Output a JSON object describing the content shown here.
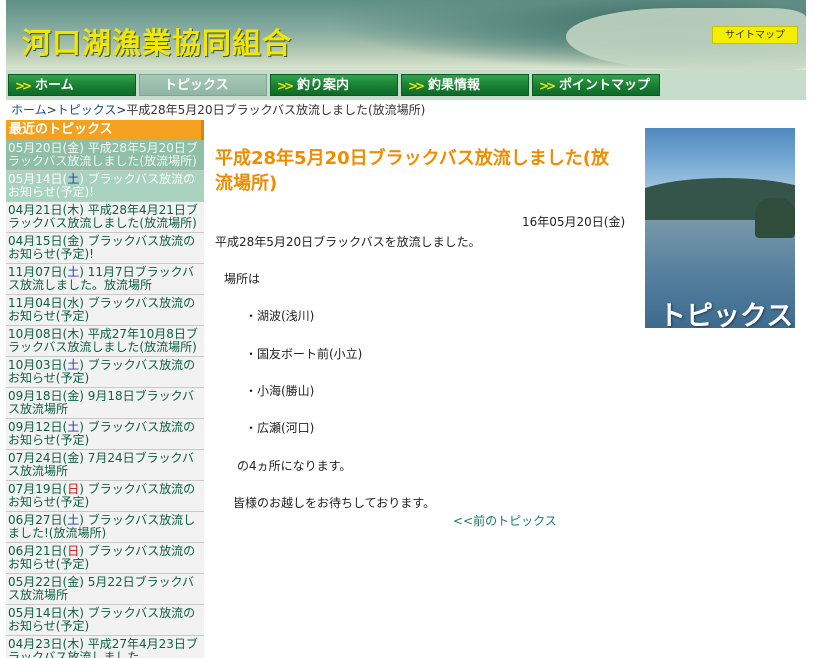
{
  "header": {
    "site_title": "河口湖漁業協同組合",
    "sitemap_label": "サイトマップ"
  },
  "nav": [
    {
      "label": "ホーム",
      "active": false
    },
    {
      "label": "トピックス",
      "active": true
    },
    {
      "label": "釣り案内",
      "active": false
    },
    {
      "label": "釣果情報",
      "active": false
    },
    {
      "label": "ポイントマップ",
      "active": false
    }
  ],
  "breadcrumb": {
    "home": "ホーム",
    "topics": "トピックス",
    "current": "平成28年5月20日ブラックバス放流しました(放流場所)",
    "sep": ">"
  },
  "sidebar": {
    "heading": "最近のトピックス",
    "items": [
      {
        "date": "05月20日(",
        "dow": "金",
        "dowtype": "",
        "rest": ") 平成28年5月20日ブラックバス放流しました(放流場所)"
      },
      {
        "date": "05月14日(",
        "dow": "土",
        "dowtype": "sat",
        "rest": ") ブラックバス放流のお知らせ(予定)!"
      },
      {
        "date": "04月21日(",
        "dow": "木",
        "dowtype": "",
        "rest": ") 平成28年4月21日ブラックバス放流しました(放流場所)"
      },
      {
        "date": "04月15日(",
        "dow": "金",
        "dowtype": "",
        "rest": ") ブラックバス放流のお知らせ(予定)!"
      },
      {
        "date": "11月07日(",
        "dow": "土",
        "dowtype": "sat",
        "rest": ") 11月7日ブラックバス放流しました。放流場所"
      },
      {
        "date": "11月04日(",
        "dow": "水",
        "dowtype": "",
        "rest": ") ブラックバス放流のお知らせ(予定)"
      },
      {
        "date": "10月08日(",
        "dow": "木",
        "dowtype": "",
        "rest": ") 平成27年10月8日ブラックバス放流しました(放流場所)"
      },
      {
        "date": "10月03日(",
        "dow": "土",
        "dowtype": "sat",
        "rest": ") ブラックバス放流のお知らせ(予定)"
      },
      {
        "date": "09月18日(",
        "dow": "金",
        "dowtype": "",
        "rest": ") 9月18日ブラックバス放流場所"
      },
      {
        "date": "09月12日(",
        "dow": "土",
        "dowtype": "sat",
        "rest": ") ブラックバス放流のお知らせ(予定)"
      },
      {
        "date": "07月24日(",
        "dow": "金",
        "dowtype": "",
        "rest": ") 7月24日ブラックバス放流場所"
      },
      {
        "date": "07月19日(",
        "dow": "日",
        "dowtype": "sun",
        "rest": ") ブラックバス放流のお知らせ(予定)"
      },
      {
        "date": "06月27日(",
        "dow": "土",
        "dowtype": "sat",
        "rest": ") ブラックバス放流しました!(放流場所)"
      },
      {
        "date": "06月21日(",
        "dow": "日",
        "dowtype": "sun",
        "rest": ") ブラックバス放流のお知らせ(予定)"
      },
      {
        "date": "05月22日(",
        "dow": "金",
        "dowtype": "",
        "rest": ") 5月22日ブラックバス放流場所"
      },
      {
        "date": "05月14日(",
        "dow": "木",
        "dowtype": "",
        "rest": ") ブラックバス放流のお知らせ(予定)"
      },
      {
        "date": "04月23日(",
        "dow": "木",
        "dowtype": "",
        "rest": ") 平成27年4月23日ブラックバス放流しました"
      }
    ]
  },
  "main": {
    "title": "平成28年5月20日ブラックバス放流しました(放流場所)",
    "date": "16年05月20日(金)",
    "intro": "平成28年5月20日ブラックバスを放流しました。",
    "place_heading": "場所は",
    "places": [
      "・湖波(浅川)",
      "・国友ボート前(小立)",
      "・小海(勝山)",
      "・広瀬(河口)"
    ],
    "count_text": "の4ヵ所になります。",
    "closing": "皆様のお越しをお待ちしております。",
    "prev_link": "<<前のトピックス",
    "image_label": "トピックス"
  }
}
